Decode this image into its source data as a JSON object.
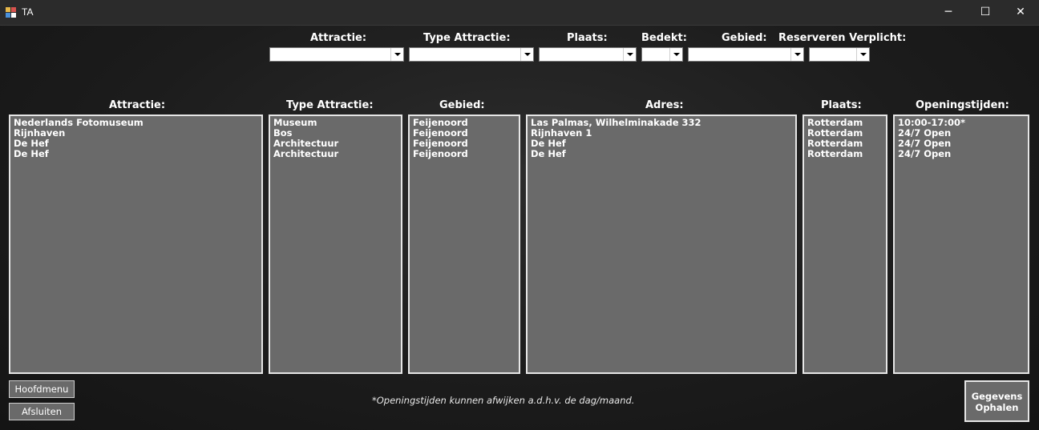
{
  "window": {
    "title": "TA",
    "controls": {
      "minimize": "─",
      "maximize": "☐",
      "close": "✕"
    }
  },
  "filters": {
    "attractie": {
      "label": "Attractie:",
      "value": ""
    },
    "type_attractie": {
      "label": "Type Attractie:",
      "value": ""
    },
    "plaats": {
      "label": "Plaats:",
      "value": ""
    },
    "bedekt": {
      "label": "Bedekt:",
      "value": ""
    },
    "gebied": {
      "label": "Gebied:",
      "value": ""
    },
    "reserveren": {
      "label": "Reserveren Verplicht:",
      "value": ""
    }
  },
  "columns": {
    "attractie": {
      "header": "Attractie:",
      "items": [
        "Nederlands Fotomuseum",
        "Rijnhaven",
        "De Hef",
        "De Hef"
      ]
    },
    "type": {
      "header": "Type Attractie:",
      "items": [
        "Museum",
        "Bos",
        "Architectuur",
        "Architectuur"
      ]
    },
    "gebied": {
      "header": "Gebied:",
      "items": [
        "Feijenoord",
        "Feijenoord",
        "Feijenoord",
        "Feijenoord"
      ]
    },
    "adres": {
      "header": "Adres:",
      "items": [
        "Las Palmas, Wilhelminakade 332",
        "Rijnhaven 1",
        "De Hef",
        "De Hef"
      ]
    },
    "plaats": {
      "header": "Plaats:",
      "items": [
        "Rotterdam",
        "Rotterdam",
        "Rotterdam",
        "Rotterdam"
      ]
    },
    "openingstijden": {
      "header": "Openingstijden:",
      "items": [
        "10:00-17:00*",
        "24/7 Open",
        "24/7 Open",
        "24/7 Open"
      ]
    }
  },
  "buttons": {
    "hoofdmenu": "Hoofdmenu",
    "afsluiten": "Afsluiten",
    "gegevens_line1": "Gegevens",
    "gegevens_line2": "Ophalen"
  },
  "note": "*Openingstijden kunnen afwijken a.d.h.v. de dag/maand.",
  "colors": {
    "titlebar": "#2b2b2b",
    "listbox_bg": "#6a6a6a",
    "listbox_border": "#e6e6e6",
    "text": "#ffffff"
  },
  "icons": {
    "app": "app-icon"
  }
}
